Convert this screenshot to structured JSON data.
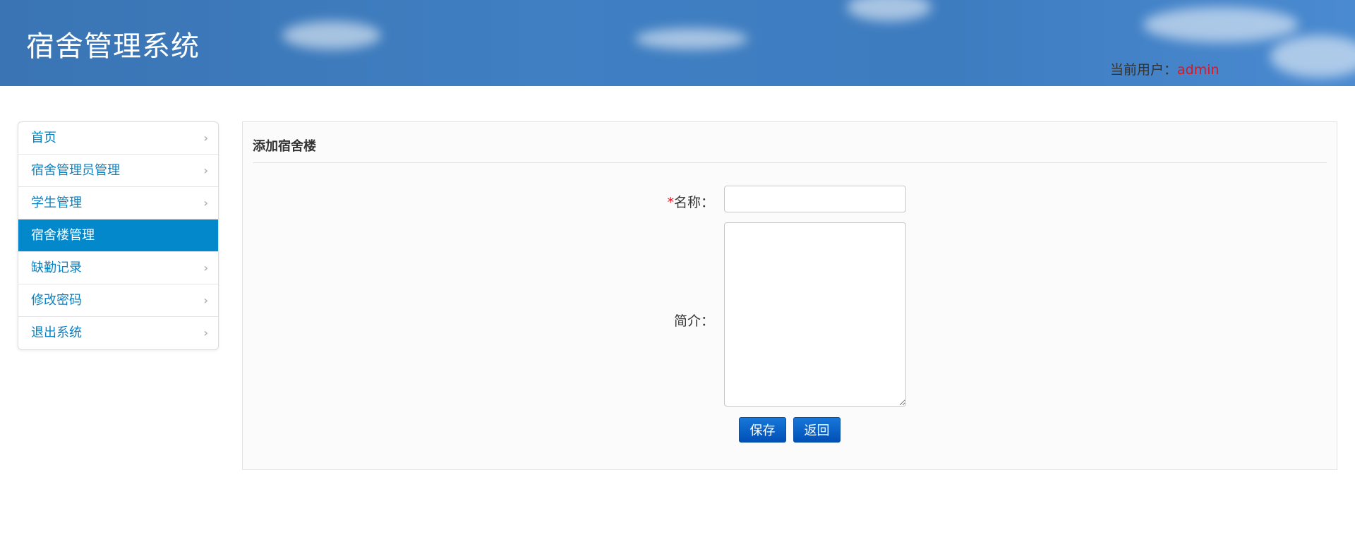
{
  "header": {
    "title": "宿舍管理系统",
    "user_label": "当前用户：",
    "username": "admin"
  },
  "sidebar": {
    "items": [
      {
        "label": "首页",
        "active": false
      },
      {
        "label": "宿舍管理员管理",
        "active": false
      },
      {
        "label": "学生管理",
        "active": false
      },
      {
        "label": "宿舍楼管理",
        "active": true
      },
      {
        "label": "缺勤记录",
        "active": false
      },
      {
        "label": "修改密码",
        "active": false
      },
      {
        "label": "退出系统",
        "active": false
      }
    ],
    "chevron_icon": "chevron-right-icon"
  },
  "form": {
    "title": "添加宿舍楼",
    "required_mark": "*",
    "name_label": "名称：",
    "name_value": "",
    "desc_label": "简介：",
    "desc_value": "",
    "save_label": "保存",
    "back_label": "返回"
  },
  "colors": {
    "header_bg": "#3e7cc0",
    "accent": "#0488cc",
    "link": "#0a81c2",
    "username": "#e4141c",
    "button": "#0a5fc8"
  }
}
